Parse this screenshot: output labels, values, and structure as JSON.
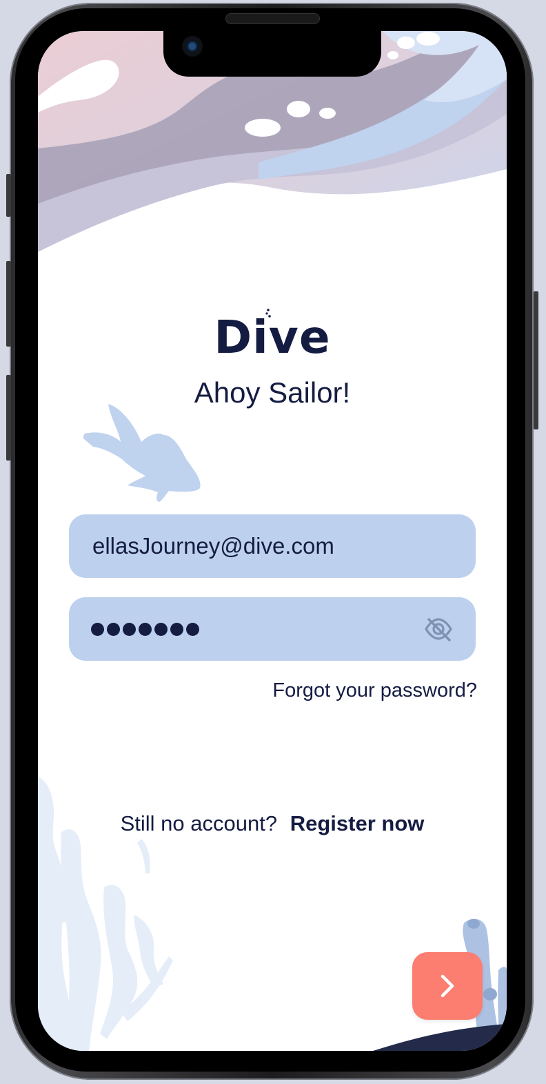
{
  "app": {
    "logo_text": "Dive",
    "greeting": "Ahoy Sailor!"
  },
  "login_form": {
    "email_value": "ellasJourney@dive.com",
    "password_masked_length": 7,
    "password_visibility_icon": "eye-slash-icon",
    "forgot_password_label": "Forgot your password?"
  },
  "register": {
    "prompt": "Still no account?",
    "link_label": "Register now"
  },
  "submit_button": {
    "icon": "chevron-right-icon"
  },
  "colors": {
    "text": "#151c42",
    "field_bg": "#bdd1ee",
    "accent_button": "#fb7e71",
    "wave_light": "#bfd2ee",
    "wave_mauve": "#a49fb5"
  }
}
